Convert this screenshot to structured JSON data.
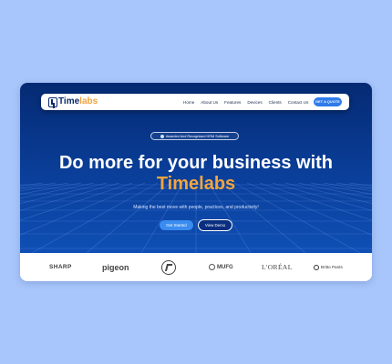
{
  "navbar": {
    "logo_text_main": "Time",
    "logo_text_accent": "labs",
    "links": [
      "Home",
      "About Us",
      "Features",
      "Devices",
      "Clients",
      "Contact Us"
    ],
    "cta_label": "GET A QUOTE"
  },
  "hero": {
    "badge_text": "Awarded And Recognised HRM Software",
    "headline_line1": "Do more for your business with",
    "headline_brand": "Timelabs",
    "tagline": "Making the best move with people, practices, and productivity!",
    "primary_button": "Get Started",
    "secondary_button": "View Demo"
  },
  "client_logos": [
    "SHARP",
    "pigeon",
    "L&T",
    "MUFG",
    "L'ORÉAL",
    "Britto Pants"
  ],
  "colors": {
    "page_background": "#a8c6fb",
    "hero_background": "#0a3f9a",
    "brand_accent": "#f3a53c",
    "button_blue": "#3a8cf0"
  }
}
